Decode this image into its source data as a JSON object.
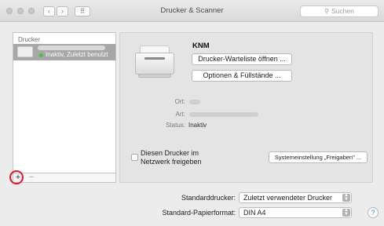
{
  "window": {
    "title": "Drucker & Scanner",
    "search_placeholder": "Suchen",
    "back_glyph": "‹",
    "forward_glyph": "›",
    "show_all_glyph": "⠿"
  },
  "sidebar": {
    "header": "Drucker",
    "printers": [
      {
        "status": "Inaktiv, Zuletzt benutzt",
        "status_color": "#3ec43e"
      }
    ],
    "add_glyph": "+",
    "remove_glyph": "−"
  },
  "detail": {
    "printer_name": "KNM",
    "open_queue_label": "Drucker-Warteliste öffnen ...",
    "options_label": "Optionen & Füllstände ...",
    "location_label": "Ort:",
    "kind_label": "Art:",
    "status_label": "Status:",
    "status_value": "Inaktiv",
    "share_label": "Diesen Drucker im Netzwerk freigeben",
    "sharing_prefs_label": "Systemeinstellung „Freigaben\" ..."
  },
  "bottom": {
    "default_printer_label": "Standarddrucker:",
    "default_printer_value": "Zuletzt verwendeter Drucker",
    "paper_size_label": "Standard-Papierformat:",
    "paper_size_value": "DIN A4",
    "help_glyph": "?"
  },
  "colors": {
    "highlight": "#e8142a",
    "selected_row": "#a7a7a7"
  }
}
